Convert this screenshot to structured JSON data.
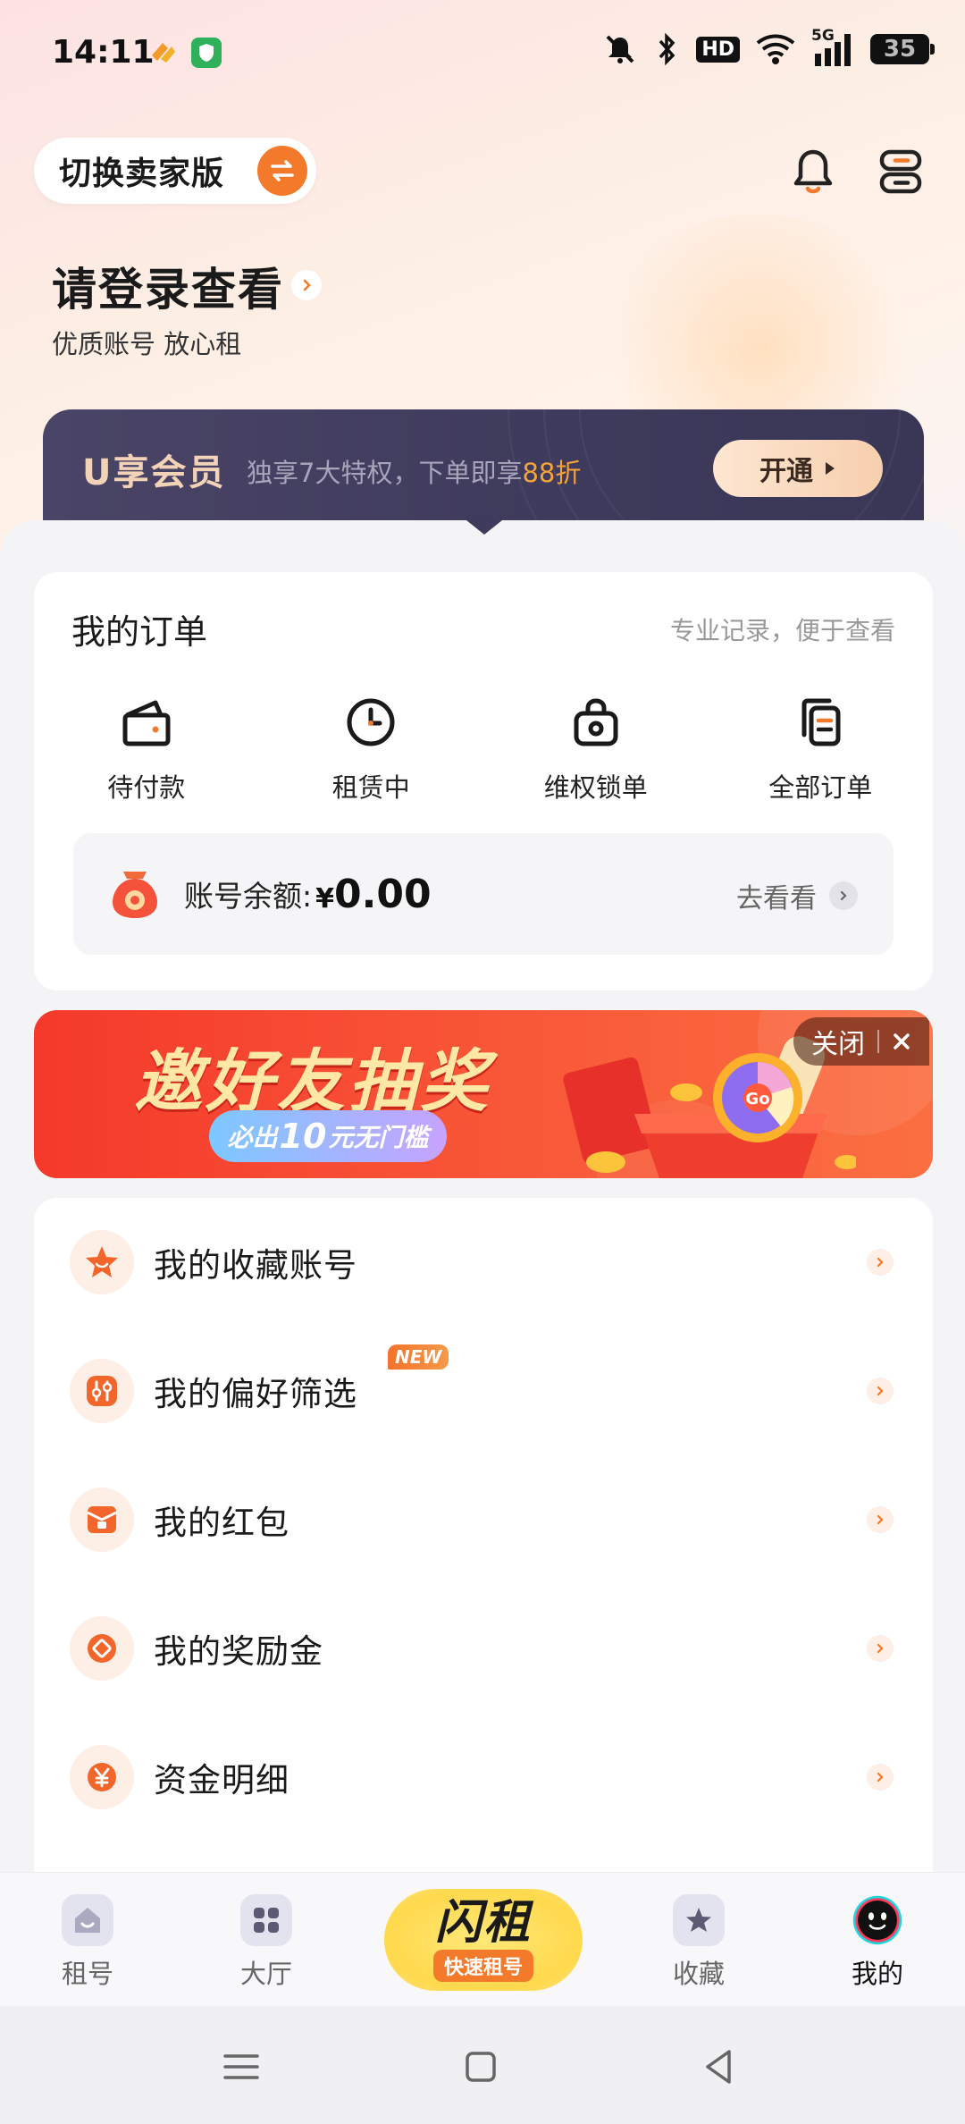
{
  "status_bar": {
    "time": "14:11",
    "hd_badge": "HD",
    "network": "5G",
    "battery": "35"
  },
  "header": {
    "seller_switch_label": "切换卖家版",
    "login_title": "请登录查看",
    "login_subtitle": "优质账号 放心租"
  },
  "vip_banner": {
    "title": "U享会员",
    "desc_prefix": "独享7大特权，下单即享",
    "desc_highlight": "88折",
    "button": "开通"
  },
  "orders": {
    "title": "我的订单",
    "hint": "专业记录，便于查看",
    "items": [
      {
        "label": "待付款",
        "icon": "wallet-icon"
      },
      {
        "label": "租赁中",
        "icon": "clock-icon"
      },
      {
        "label": "维权锁单",
        "icon": "lock-bag-icon"
      },
      {
        "label": "全部订单",
        "icon": "documents-icon"
      }
    ],
    "balance_label": "账号余额:",
    "balance_currency": "¥",
    "balance_value": "0.00",
    "balance_link": "去看看"
  },
  "promo": {
    "title": "邀好友抽奖",
    "pill_prefix": "必出",
    "pill_amount": "10",
    "pill_suffix": "元无门槛",
    "close_label": "关闭",
    "wheel_text": "Go"
  },
  "menu": {
    "items": [
      {
        "label": "我的收藏账号",
        "icon": "star-icon"
      },
      {
        "label": "我的偏好筛选",
        "icon": "filter-icon",
        "badge": "NEW"
      },
      {
        "label": "我的红包",
        "icon": "red-packet-icon"
      },
      {
        "label": "我的奖励金",
        "icon": "reward-coin-icon"
      },
      {
        "label": "资金明细",
        "icon": "yen-icon"
      }
    ]
  },
  "tabbar": {
    "tabs": [
      {
        "label": "租号",
        "icon": "home-icon"
      },
      {
        "label": "大厅",
        "icon": "grid-icon"
      },
      {
        "label": "收藏",
        "icon": "star-icon"
      },
      {
        "label": "我的",
        "icon": "avatar-icon",
        "active": true
      }
    ],
    "flash_title": "闪租",
    "flash_subtitle": "快速租号"
  },
  "colors": {
    "accent": "#f37a2b",
    "vip_bg": "#3f3b5c",
    "promo_red": "#f4392b",
    "highlight": "#f6a43a"
  }
}
